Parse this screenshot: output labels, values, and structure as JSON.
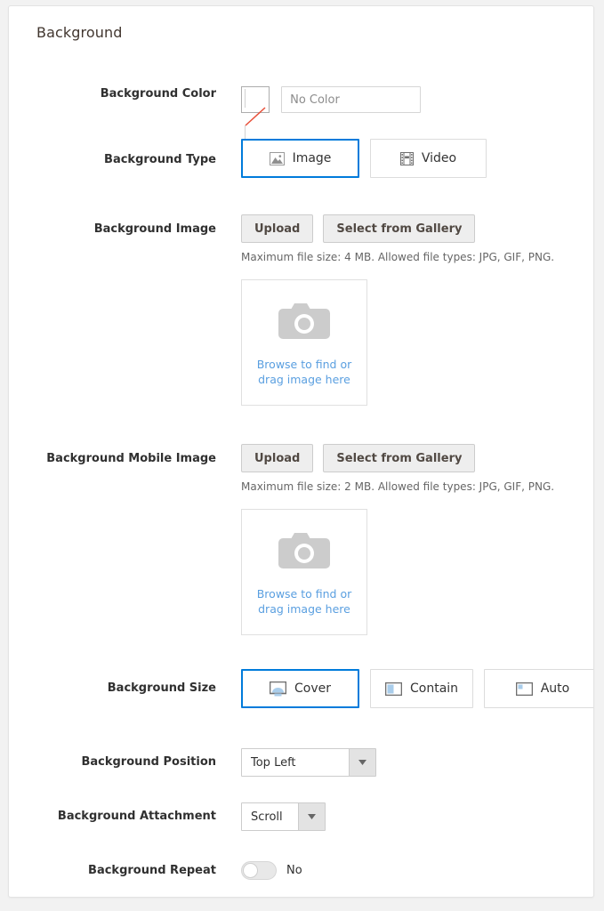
{
  "panel": {
    "title": "Background"
  },
  "accent": {
    "selected_border": "#007bdb",
    "link": "#5a9fe0",
    "icon_blue": "#a9cdeb",
    "swatch_slash": "#e8503a"
  },
  "fields": {
    "background_color": {
      "label": "Background Color",
      "swatch_icon": "no-color-swatch-icon",
      "value": "",
      "placeholder": "No Color"
    },
    "background_type": {
      "label": "Background Type",
      "options": [
        {
          "label": "Image",
          "icon": "image-icon",
          "selected": true
        },
        {
          "label": "Video",
          "icon": "film-icon",
          "selected": false
        }
      ]
    },
    "background_image": {
      "label": "Background Image",
      "upload_label": "Upload",
      "gallery_label": "Select from Gallery",
      "hint": "Maximum file size: 4 MB. Allowed file types: JPG, GIF, PNG.",
      "dropzone": {
        "icon": "camera-icon",
        "line1": "Browse to find or",
        "line2": "drag image here"
      }
    },
    "background_mobile_image": {
      "label": "Background Mobile Image",
      "upload_label": "Upload",
      "gallery_label": "Select from Gallery",
      "hint": "Maximum file size: 2 MB. Allowed file types: JPG, GIF, PNG.",
      "dropzone": {
        "icon": "camera-icon",
        "line1": "Browse to find or",
        "line2": "drag image here"
      }
    },
    "background_size": {
      "label": "Background Size",
      "options": [
        {
          "label": "Cover",
          "icon": "monitor-cover-icon",
          "selected": true
        },
        {
          "label": "Contain",
          "icon": "monitor-contain-icon",
          "selected": false
        },
        {
          "label": "Auto",
          "icon": "monitor-auto-icon",
          "selected": false
        }
      ]
    },
    "background_position": {
      "label": "Background Position",
      "value": "Top Left",
      "arrow_icon": "chevron-down-icon"
    },
    "background_attachment": {
      "label": "Background Attachment",
      "value": "Scroll",
      "arrow_icon": "chevron-down-icon"
    },
    "background_repeat": {
      "label": "Background Repeat",
      "state_label": "No",
      "checked": false
    }
  }
}
